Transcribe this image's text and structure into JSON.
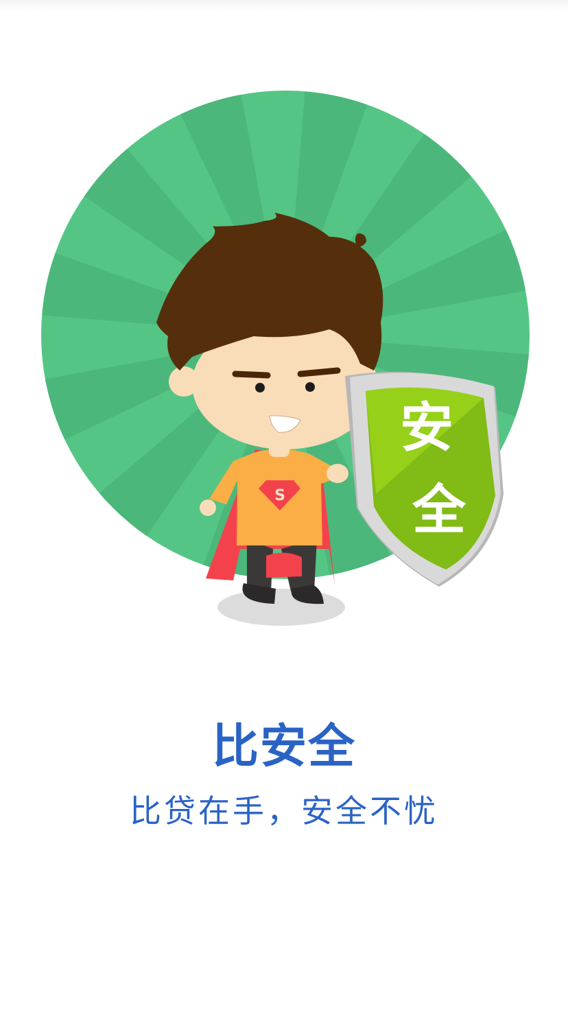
{
  "slide": {
    "title": "比安全",
    "subtitle": "比贷在手，安全不忧"
  },
  "illustration": {
    "shield_char_1": "安",
    "shield_char_2": "全",
    "chest_emblem": "S",
    "icons": [
      "sunburst-circle",
      "superhero-boy",
      "shield-icon"
    ]
  },
  "colors": {
    "accent_text": "#2a63c6",
    "circle_green_light": "#55c585",
    "circle_green_dark": "#4cb77a",
    "shield_green": "#7fbb16",
    "cape_red": "#f4424c",
    "shirt_orange": "#fbae45"
  }
}
